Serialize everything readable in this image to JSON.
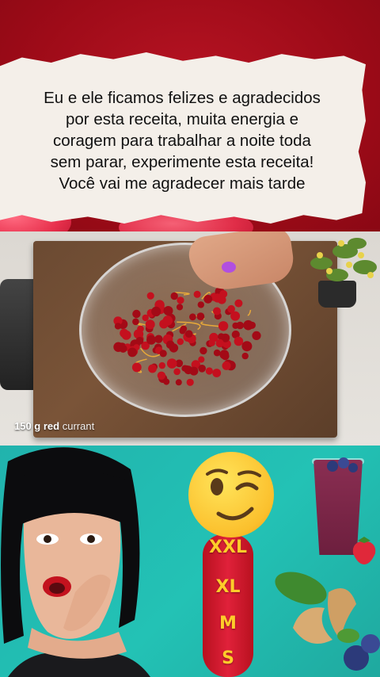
{
  "banner": {
    "text": "Eu e ele ficamos felizes e agradecidos\npor esta receita, muita energia e\ncoragem para trabalhar a noite toda\nsem parar, experimente esta receita!\nVocê vai me agradecer mais tarde"
  },
  "video": {
    "caption_bold": "150 g red",
    "caption_light": "currant"
  },
  "ad": {
    "sizes": [
      "XXL",
      "XL",
      "M",
      "S"
    ],
    "emoji": "winking-face-icon"
  },
  "colors": {
    "banner_red": "#a30f1d",
    "ad_teal": "#23c2b5",
    "size_yellow": "#ffcc2a"
  }
}
